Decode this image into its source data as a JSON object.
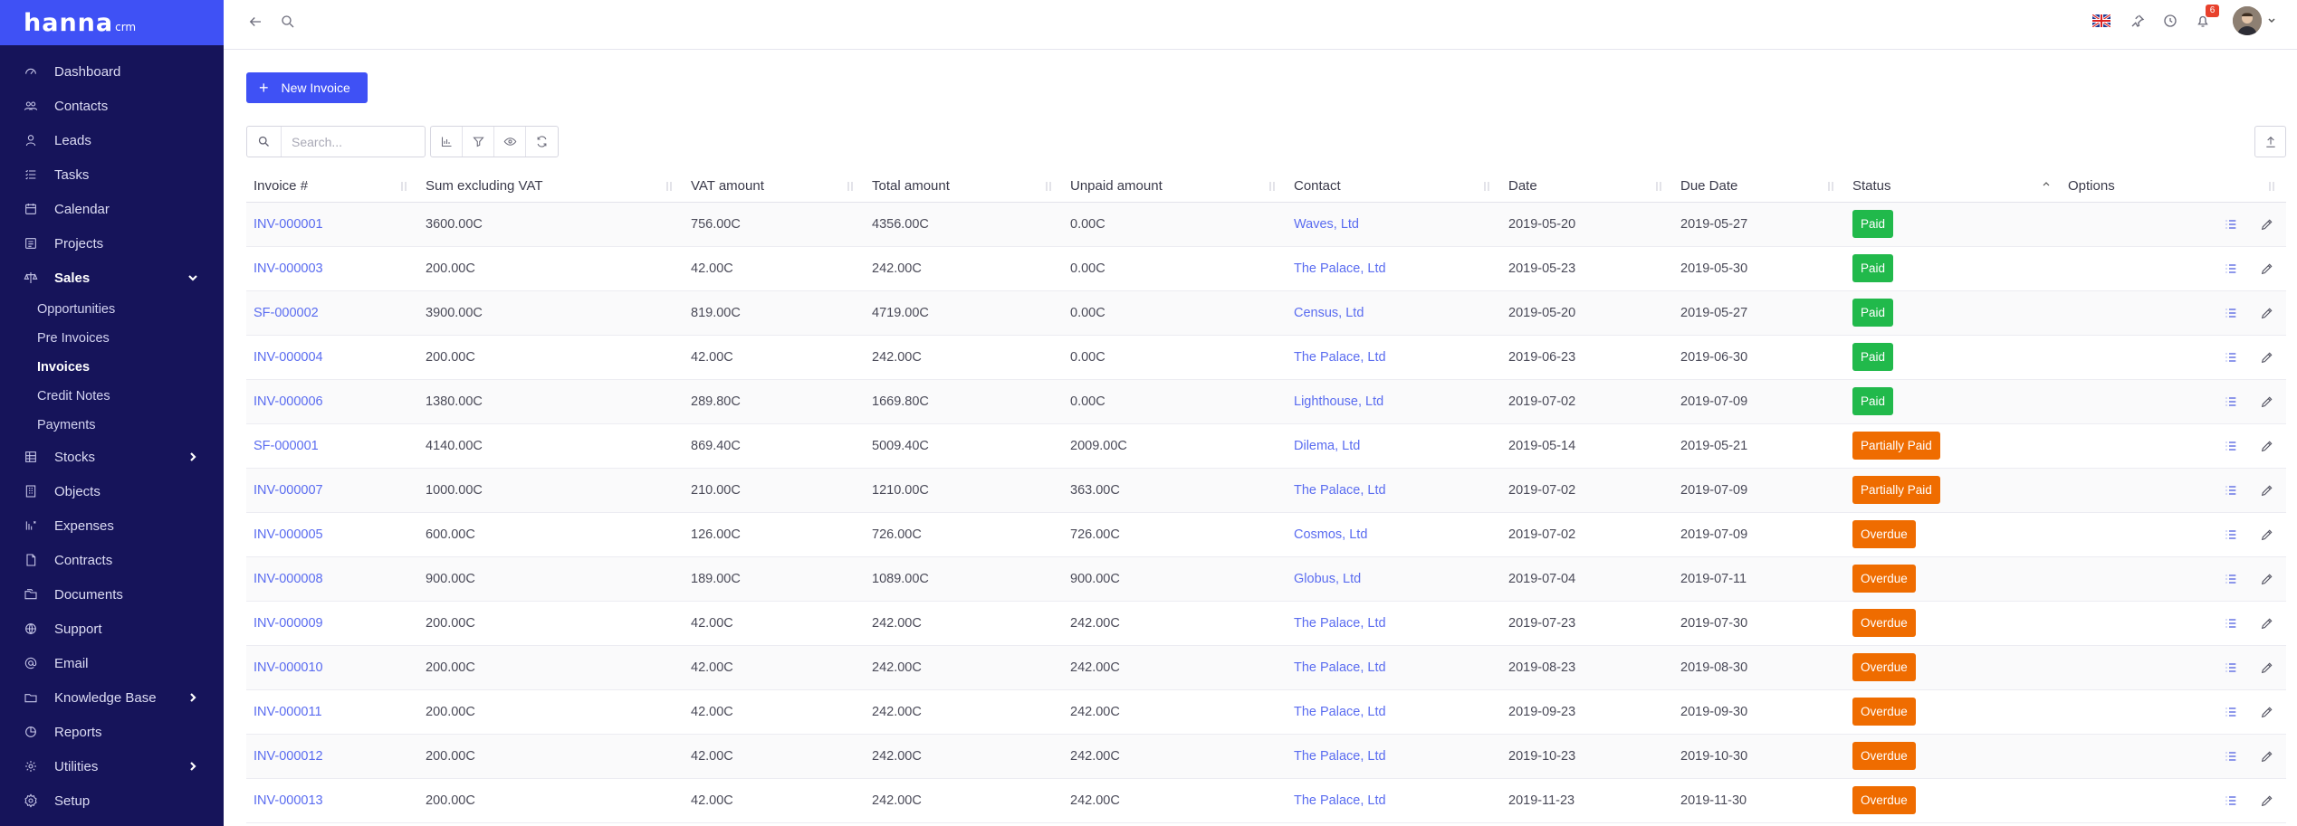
{
  "app": {
    "logo": "hanna",
    "logo_suffix": "crm"
  },
  "sidebar": {
    "items": [
      {
        "label": "Dashboard",
        "icon": "dashboard-icon"
      },
      {
        "label": "Contacts",
        "icon": "contacts-icon"
      },
      {
        "label": "Leads",
        "icon": "leads-icon"
      },
      {
        "label": "Tasks",
        "icon": "tasks-icon"
      },
      {
        "label": "Calendar",
        "icon": "calendar-icon"
      },
      {
        "label": "Projects",
        "icon": "projects-icon"
      },
      {
        "label": "Sales",
        "icon": "sales-icon",
        "expanded": true
      },
      {
        "label": "Stocks",
        "icon": "stocks-icon",
        "has_children": true
      },
      {
        "label": "Objects",
        "icon": "objects-icon"
      },
      {
        "label": "Expenses",
        "icon": "expenses-icon"
      },
      {
        "label": "Contracts",
        "icon": "contracts-icon"
      },
      {
        "label": "Documents",
        "icon": "documents-icon"
      },
      {
        "label": "Support",
        "icon": "support-icon"
      },
      {
        "label": "Email",
        "icon": "email-icon"
      },
      {
        "label": "Knowledge Base",
        "icon": "knowledge-base-icon",
        "has_children": true
      },
      {
        "label": "Reports",
        "icon": "reports-icon"
      },
      {
        "label": "Utilities",
        "icon": "utilities-icon",
        "has_children": true
      },
      {
        "label": "Setup",
        "icon": "setup-icon"
      }
    ],
    "sales_sub": [
      {
        "label": "Opportunities"
      },
      {
        "label": "Pre Invoices"
      },
      {
        "label": "Invoices",
        "active": true
      },
      {
        "label": "Credit Notes"
      },
      {
        "label": "Payments"
      }
    ]
  },
  "topbar": {
    "notification_count": "6"
  },
  "toolbar": {
    "new_invoice_label": "New Invoice",
    "search_placeholder": "Search..."
  },
  "table": {
    "columns": [
      "Invoice #",
      "Sum excluding VAT",
      "VAT amount",
      "Total amount",
      "Unpaid amount",
      "Contact",
      "Date",
      "Due Date",
      "Status",
      "Options"
    ],
    "rows": [
      {
        "invoice": "INV-000001",
        "sum": "3600.00C",
        "vat": "756.00C",
        "total": "4356.00C",
        "unpaid": "0.00C",
        "contact": "Waves, Ltd",
        "date": "2019-05-20",
        "due": "2019-05-27",
        "status": "Paid"
      },
      {
        "invoice": "INV-000003",
        "sum": "200.00C",
        "vat": "42.00C",
        "total": "242.00C",
        "unpaid": "0.00C",
        "contact": "The Palace, Ltd",
        "date": "2019-05-23",
        "due": "2019-05-30",
        "status": "Paid"
      },
      {
        "invoice": "SF-000002",
        "sum": "3900.00C",
        "vat": "819.00C",
        "total": "4719.00C",
        "unpaid": "0.00C",
        "contact": "Census, Ltd",
        "date": "2019-05-20",
        "due": "2019-05-27",
        "status": "Paid"
      },
      {
        "invoice": "INV-000004",
        "sum": "200.00C",
        "vat": "42.00C",
        "total": "242.00C",
        "unpaid": "0.00C",
        "contact": "The Palace, Ltd",
        "date": "2019-06-23",
        "due": "2019-06-30",
        "status": "Paid"
      },
      {
        "invoice": "INV-000006",
        "sum": "1380.00C",
        "vat": "289.80C",
        "total": "1669.80C",
        "unpaid": "0.00C",
        "contact": "Lighthouse, Ltd",
        "date": "2019-07-02",
        "due": "2019-07-09",
        "status": "Paid"
      },
      {
        "invoice": "SF-000001",
        "sum": "4140.00C",
        "vat": "869.40C",
        "total": "5009.40C",
        "unpaid": "2009.00C",
        "contact": "Dilema, Ltd",
        "date": "2019-05-14",
        "due": "2019-05-21",
        "status": "Partially Paid"
      },
      {
        "invoice": "INV-000007",
        "sum": "1000.00C",
        "vat": "210.00C",
        "total": "1210.00C",
        "unpaid": "363.00C",
        "contact": "The Palace, Ltd",
        "date": "2019-07-02",
        "due": "2019-07-09",
        "status": "Partially Paid"
      },
      {
        "invoice": "INV-000005",
        "sum": "600.00C",
        "vat": "126.00C",
        "total": "726.00C",
        "unpaid": "726.00C",
        "contact": "Cosmos, Ltd",
        "date": "2019-07-02",
        "due": "2019-07-09",
        "status": "Overdue"
      },
      {
        "invoice": "INV-000008",
        "sum": "900.00C",
        "vat": "189.00C",
        "total": "1089.00C",
        "unpaid": "900.00C",
        "contact": "Globus, Ltd",
        "date": "2019-07-04",
        "due": "2019-07-11",
        "status": "Overdue"
      },
      {
        "invoice": "INV-000009",
        "sum": "200.00C",
        "vat": "42.00C",
        "total": "242.00C",
        "unpaid": "242.00C",
        "contact": "The Palace, Ltd",
        "date": "2019-07-23",
        "due": "2019-07-30",
        "status": "Overdue"
      },
      {
        "invoice": "INV-000010",
        "sum": "200.00C",
        "vat": "42.00C",
        "total": "242.00C",
        "unpaid": "242.00C",
        "contact": "The Palace, Ltd",
        "date": "2019-08-23",
        "due": "2019-08-30",
        "status": "Overdue"
      },
      {
        "invoice": "INV-000011",
        "sum": "200.00C",
        "vat": "42.00C",
        "total": "242.00C",
        "unpaid": "242.00C",
        "contact": "The Palace, Ltd",
        "date": "2019-09-23",
        "due": "2019-09-30",
        "status": "Overdue"
      },
      {
        "invoice": "INV-000012",
        "sum": "200.00C",
        "vat": "42.00C",
        "total": "242.00C",
        "unpaid": "242.00C",
        "contact": "The Palace, Ltd",
        "date": "2019-10-23",
        "due": "2019-10-30",
        "status": "Overdue"
      },
      {
        "invoice": "INV-000013",
        "sum": "200.00C",
        "vat": "42.00C",
        "total": "242.00C",
        "unpaid": "242.00C",
        "contact": "The Palace, Ltd",
        "date": "2019-11-23",
        "due": "2019-11-30",
        "status": "Overdue"
      }
    ]
  },
  "colors": {
    "sidebar_bg": "#16145a",
    "accent": "#3f51f5",
    "link": "#5a6cf0",
    "status_paid": "#21b94b",
    "status_partially_paid": "#ef6c00",
    "status_overdue": "#ef6c00"
  }
}
